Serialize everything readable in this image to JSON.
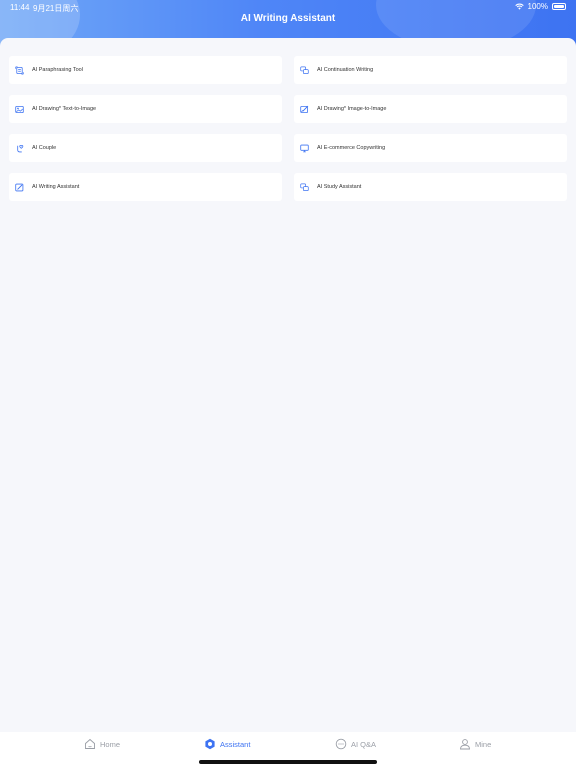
{
  "status_bar": {
    "time": "11:44",
    "date": "9月21日周六",
    "battery": "100%"
  },
  "header": {
    "title": "AI Writing Assistant"
  },
  "tools": [
    {
      "label": "AI Paraphrasing Tool",
      "icon": "document-scan-icon"
    },
    {
      "label": "AI Continuation Writing",
      "icon": "speech-bubbles-icon"
    },
    {
      "label": "AI Drawing* Text-to-Image",
      "icon": "picture-icon"
    },
    {
      "label": "AI Drawing* Image-to-Image",
      "icon": "edit-picture-icon"
    },
    {
      "label": "AI Couple",
      "icon": "hand-heart-icon"
    },
    {
      "label": "AI E-commerce Copywriting",
      "icon": "monitor-icon"
    },
    {
      "label": "AI Writing Assistant",
      "icon": "pen-edit-icon"
    },
    {
      "label": "AI Study Assistant",
      "icon": "chat-bubbles-icon"
    }
  ],
  "tabbar": {
    "home": "Home",
    "assistant": "Assistant",
    "qa": "AI Q&A",
    "mine": "Mine",
    "active": "assistant"
  },
  "colors": {
    "accent": "#3d73f2",
    "tab_inactive": "#9a9ea6",
    "background": "#f6f7fb"
  }
}
